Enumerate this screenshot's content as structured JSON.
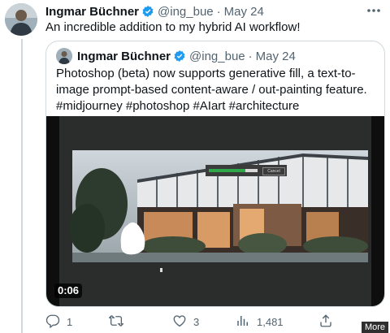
{
  "tweet": {
    "author_name": "Ingmar Büchner",
    "handle": "@ing_bue",
    "separator": "·",
    "date": "May 24",
    "text": "An incredible addition to my hybrid AI workflow!"
  },
  "quoted_tweet": {
    "author_name": "Ingmar Büchner",
    "handle": "@ing_bue",
    "separator": "·",
    "date": "May 24",
    "text": "Photoshop (beta) now supports generative fill, a text-to-image prompt-based content-aware / out-painting feature. #midjourney #photoshop #AIart #architecture",
    "video_duration": "0:06",
    "video_progress_fraction": 0.75,
    "video_dialog_button": "Cancel"
  },
  "actions": {
    "replies": "1",
    "retweets": "",
    "likes": "3",
    "views": "1,481"
  },
  "overlay": {
    "more_label": "More"
  },
  "icons": [
    "more-icon",
    "verified-badge-icon",
    "reply-icon",
    "retweet-icon",
    "like-icon",
    "views-icon",
    "share-icon"
  ],
  "colors": {
    "verified": "#1d9bf0",
    "muted": "#536471",
    "text": "#0f1419",
    "border": "#cfd9de"
  }
}
